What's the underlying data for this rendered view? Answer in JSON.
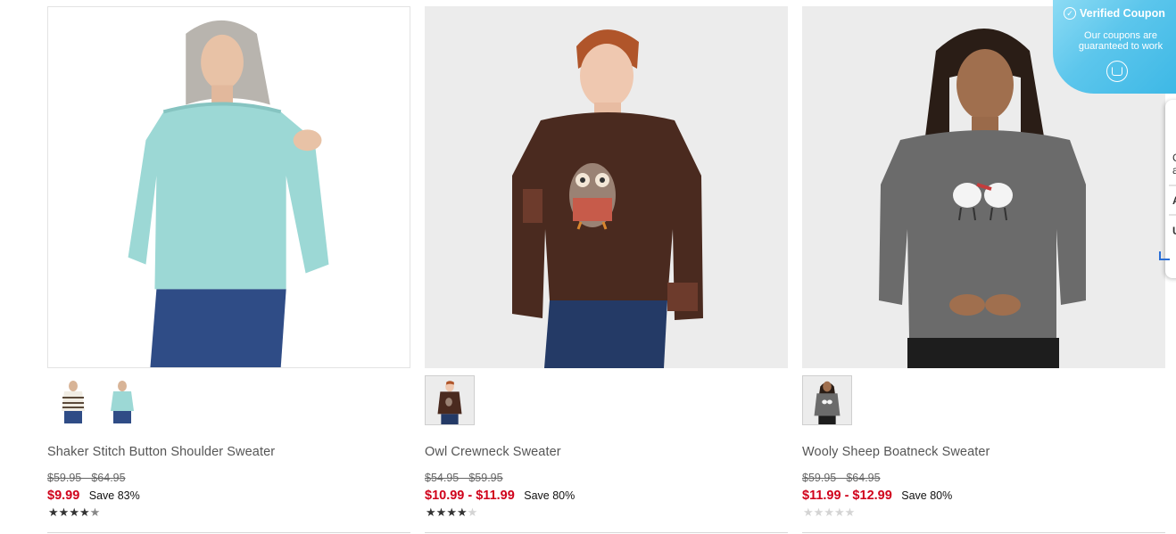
{
  "products": [
    {
      "title": "Shaker Stitch Button Shoulder Sweater",
      "original_price": "$59.95 - $64.95",
      "sale_price": "$9.99",
      "save": "Save 83%",
      "rating": 4.5,
      "sweater_color": "#9cd8d5",
      "thumbs": [
        "striped-sweater",
        "aqua-sweater"
      ]
    },
    {
      "title": "Owl Crewneck Sweater",
      "original_price": "$54.95 - $59.95",
      "sale_price": "$10.99 - $11.99",
      "save": "Save 80%",
      "rating": 4,
      "sweater_color": "#4a2a1f",
      "thumbs": [
        "owl-sweater"
      ]
    },
    {
      "title": "Wooly Sheep Boatneck Sweater",
      "original_price": "$59.95 - $64.95",
      "sale_price": "$11.99 - $12.99",
      "save": "Save 80%",
      "rating": 0,
      "sweater_color": "#6b6b6b",
      "thumbs": [
        "sheep-sweater"
      ]
    }
  ],
  "coupon": {
    "title": "Verified Coupon",
    "subtitle": "Our coupons are guaranteed to work",
    "icon": "check-circle-icon",
    "color": "#34b4e4"
  },
  "side_panel": {
    "lines": [
      "C",
      "a",
      "A",
      "U"
    ]
  },
  "colors": {
    "sale": "#d0021b",
    "star": "#333333"
  }
}
